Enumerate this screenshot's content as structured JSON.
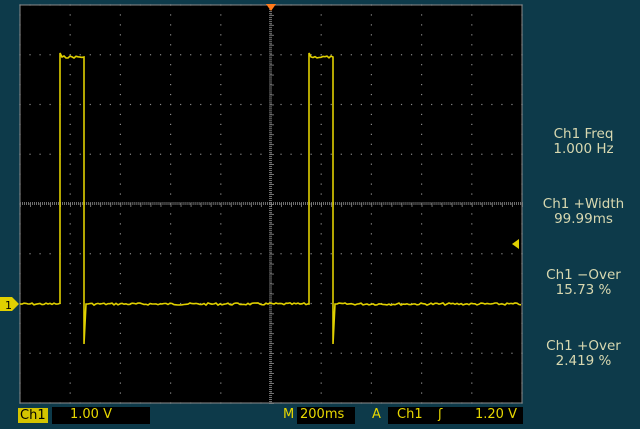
{
  "colors": {
    "screen": "#000000",
    "frame": "#0d3a4a",
    "grid": "#8a8a8a",
    "trace": "#e0d000",
    "marker": "#ff7a1a",
    "text": "#d8d8b0"
  },
  "channel_marker": "1",
  "measurements": [
    {
      "name": "Ch1 Freq",
      "value": "1.000 Hz"
    },
    {
      "name": "Ch1 +Width",
      "value": "99.99ms"
    },
    {
      "name": "Ch1 −Over",
      "value": "15.73 %"
    },
    {
      "name": "Ch1 +Over",
      "value": "2.419 %"
    }
  ],
  "status_bar": {
    "channel_label": "Ch1",
    "volts_per_div": "1.00 V",
    "timebase_prefix": "M",
    "time_per_div": "200ms",
    "trigger_mode": "A",
    "trigger_source": "Ch1",
    "trigger_slope": "ʃ",
    "trigger_level": "1.20 V"
  },
  "icons": {
    "trigger_position": "orange-down-triangle-icon",
    "trigger_level": "yellow-left-arrow-icon",
    "ground_marker": "channel-1-ground-icon"
  }
}
